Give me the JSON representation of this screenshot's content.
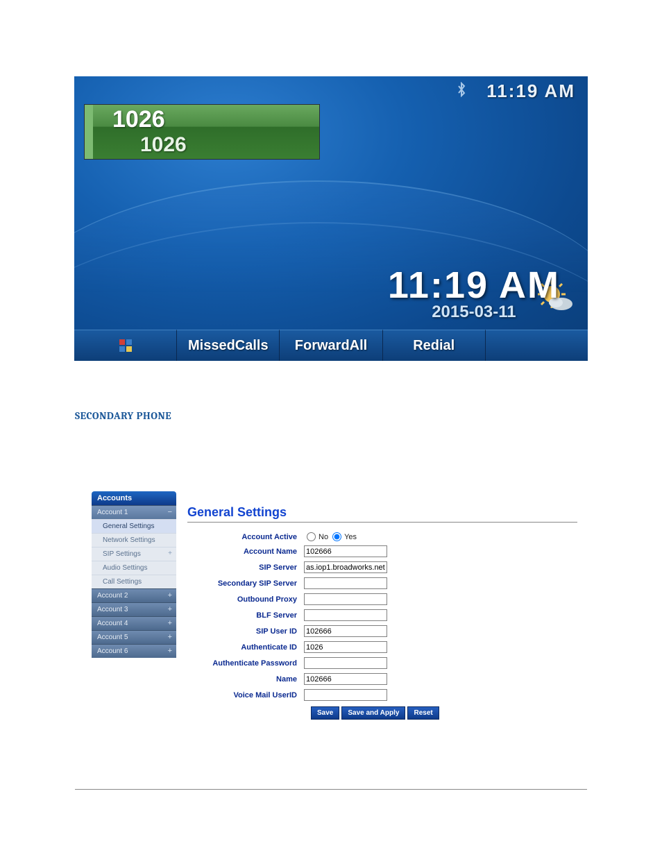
{
  "phone": {
    "top_time": "11:19 AM",
    "line": {
      "number": "1026",
      "label": "1026"
    },
    "big_time": "11:19 AM",
    "big_date": "2015-03-11",
    "softkeys": {
      "k2": "MissedCalls",
      "k3": "ForwardAll",
      "k4": "Redial"
    }
  },
  "section_title": "SECONDARY PHONE",
  "admin": {
    "sidebar_title": "Accounts",
    "accounts": [
      {
        "label": "Account 1",
        "expanded": true,
        "items": [
          {
            "label": "General Settings",
            "selected": true
          },
          {
            "label": "Network Settings"
          },
          {
            "label": "SIP Settings",
            "has_children": true
          },
          {
            "label": "Audio Settings"
          },
          {
            "label": "Call Settings"
          }
        ]
      },
      {
        "label": "Account 2"
      },
      {
        "label": "Account 3"
      },
      {
        "label": "Account 4"
      },
      {
        "label": "Account 5"
      },
      {
        "label": "Account 6"
      }
    ],
    "content_title": "General Settings",
    "fields": {
      "account_active": {
        "label": "Account Active",
        "no": "No",
        "yes": "Yes",
        "value": "Yes"
      },
      "account_name": {
        "label": "Account Name",
        "value": "102666"
      },
      "sip_server": {
        "label": "SIP Server",
        "value": "as.iop1.broadworks.net"
      },
      "sec_sip": {
        "label": "Secondary SIP Server",
        "value": ""
      },
      "outbound": {
        "label": "Outbound Proxy",
        "value": ""
      },
      "blf": {
        "label": "BLF Server",
        "value": ""
      },
      "sip_user": {
        "label": "SIP User ID",
        "value": "102666"
      },
      "auth_id": {
        "label": "Authenticate ID",
        "value": "1026"
      },
      "auth_pw": {
        "label": "Authenticate Password",
        "value": ""
      },
      "name": {
        "label": "Name",
        "value": "102666"
      },
      "vm_user": {
        "label": "Voice Mail UserID",
        "value": ""
      }
    },
    "buttons": {
      "save": "Save",
      "save_apply": "Save and Apply",
      "reset": "Reset"
    }
  }
}
